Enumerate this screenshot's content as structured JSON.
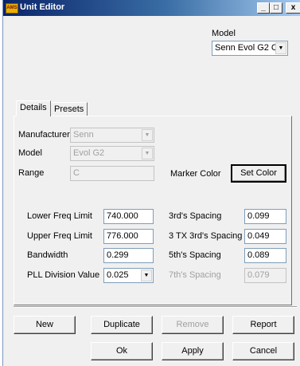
{
  "window": {
    "title": "Unit Editor",
    "icon_text": "AMS"
  },
  "titlebar": {
    "minimize_glyph": "_",
    "maximize_glyph": "□",
    "close_glyph": "x"
  },
  "header": {
    "model_label": "Model",
    "model_value": "Senn Evol G2 C"
  },
  "tabs": [
    {
      "label": "Details"
    },
    {
      "label": "Presets"
    }
  ],
  "details": {
    "manufacturer_label": "Manufacturer",
    "manufacturer_value": "Senn",
    "model_label": "Model",
    "model_value": "Evol G2",
    "range_label": "Range",
    "range_value": "C",
    "marker_color_label": "Marker Color",
    "set_color_label": "Set Color",
    "lower_freq_label": "Lower Freq Limit",
    "lower_freq_value": "740.000",
    "upper_freq_label": "Upper Freq Limit",
    "upper_freq_value": "776.000",
    "bandwidth_label": "Bandwidth",
    "bandwidth_value": "0.299",
    "pll_label": "PLL Division Value",
    "pll_value": "0.025",
    "third_spacing_label": "3rd's Spacing",
    "third_spacing_value": "0.099",
    "three_tx_label": "3 TX 3rd's Spacing",
    "three_tx_value": "0.049",
    "fifth_spacing_label": "5th's Spacing",
    "fifth_spacing_value": "0.089",
    "seventh_spacing_label": "7th's Spacing",
    "seventh_spacing_value": "0.079"
  },
  "buttons": {
    "new": "New",
    "duplicate": "Duplicate",
    "remove": "Remove",
    "report": "Report",
    "ok": "Ok",
    "apply": "Apply",
    "cancel": "Cancel"
  },
  "arrow_glyph": "▼"
}
